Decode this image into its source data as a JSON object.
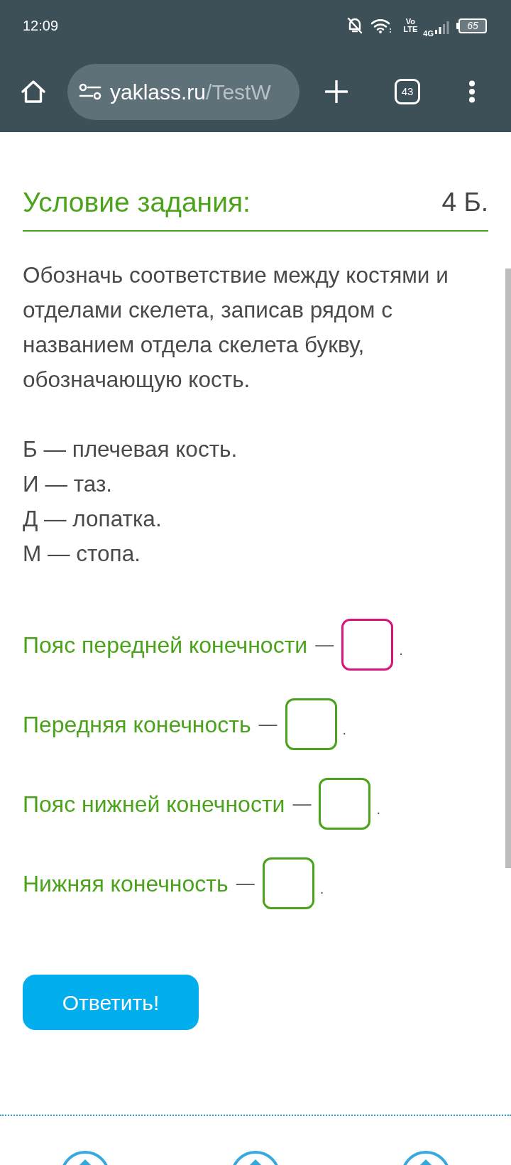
{
  "status_bar": {
    "time": "12:09",
    "volte_top": "Vo",
    "volte_bottom": "LTE",
    "network": "4G",
    "battery": "65"
  },
  "browser_bar": {
    "url_domain": "yaklass.ru",
    "url_path": "/TestW",
    "tab_count": "43"
  },
  "task": {
    "title": "Условие задания:",
    "points": "4 Б.",
    "instruction": "Обозначь соответствие между костями и отделами скелета, записав рядом с названием отдела скелета букву, обозначающую кость.",
    "bones": [
      "Б — плечевая кость.",
      "И — таз.",
      "Д — лопатка.",
      "М — стопа."
    ],
    "answers": [
      {
        "label": "Пояс передней конечности",
        "dash": "—",
        "focused": true,
        "end": "."
      },
      {
        "label": "Передняя конечность",
        "dash": "—",
        "focused": false,
        "end": "."
      },
      {
        "label": "Пояс нижней конечности",
        "dash": "—",
        "focused": false,
        "end": "."
      },
      {
        "label": "Нижняя конечность",
        "dash": "—",
        "focused": false,
        "end": "."
      }
    ],
    "submit_button": "Ответить!"
  }
}
